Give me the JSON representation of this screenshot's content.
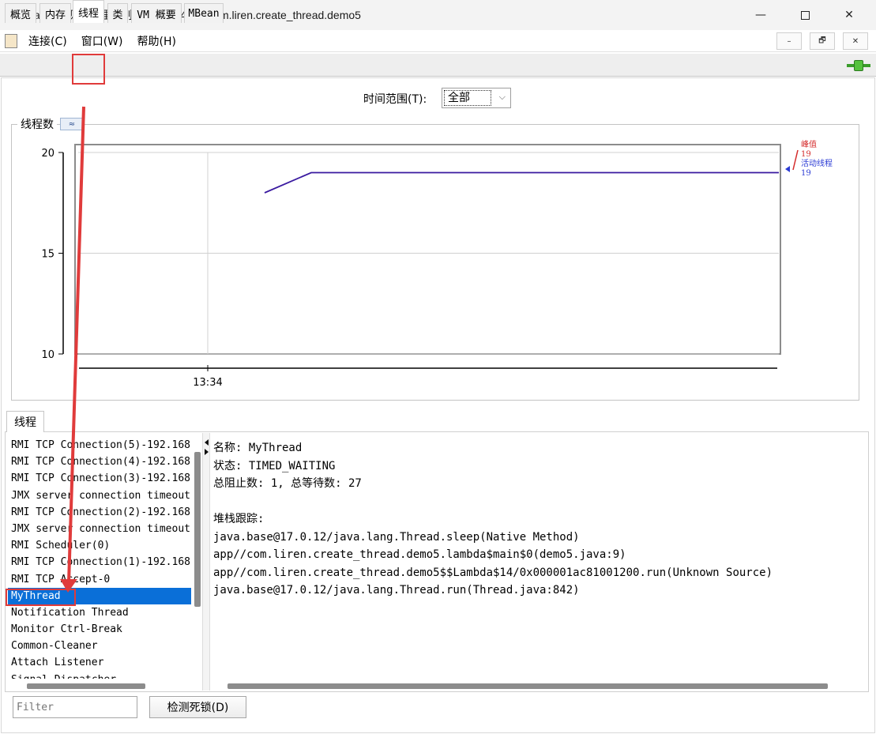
{
  "window": {
    "title": "Java 监视和管理控制台 - pid: 24128 com.liren.create_thread.demo5",
    "minimize": "—",
    "close": "✕"
  },
  "menu": {
    "items": [
      "连接(C)",
      "窗口(W)",
      "帮助(H)"
    ],
    "mdi_buttons": [
      "–",
      "🗗",
      "✕"
    ]
  },
  "tabs": [
    "概览",
    "内存",
    "线程",
    "类",
    "VM 概要",
    "MBean"
  ],
  "time_range": {
    "label": "时间范围(T):",
    "value": "全部",
    "chevron": "⌵"
  },
  "chart_section": {
    "title": "线程数",
    "collapse": "≈"
  },
  "chart_data": {
    "type": "line",
    "yticks": [
      "20",
      "15",
      "10"
    ],
    "ylim": [
      10,
      20
    ],
    "xticks": [
      "13:34"
    ],
    "series": [
      {
        "name": "峰值",
        "color": "#d42b2b",
        "value": "19"
      },
      {
        "name": "活动线程",
        "color": "#2b3bd4",
        "value": "19",
        "points": [
          18,
          19,
          19,
          19,
          19
        ]
      }
    ],
    "grid": true,
    "legend": "right"
  },
  "threads_section": {
    "tab": "线程",
    "list": [
      "RMI TCP Connection(5)-192.168",
      "RMI TCP Connection(4)-192.168",
      "RMI TCP Connection(3)-192.168",
      "JMX server connection timeout",
      "RMI TCP Connection(2)-192.168",
      "JMX server connection timeout",
      "RMI Scheduler(0)",
      "RMI TCP Connection(1)-192.168",
      "RMI TCP Accept-0",
      "MyThread",
      "Notification Thread",
      "Monitor Ctrl-Break",
      "Common-Cleaner",
      "Attach Listener",
      "Signal Dispatcher"
    ],
    "selected": "MyThread",
    "detail": [
      "名称: MyThread",
      "状态: TIMED_WAITING",
      "总阻止数: 1, 总等待数: 27",
      "",
      "堆栈跟踪:",
      "java.base@17.0.12/java.lang.Thread.sleep(Native Method)",
      "app//com.liren.create_thread.demo5.lambda$main$0(demo5.java:9)",
      "app//com.liren.create_thread.demo5$$Lambda$14/0x000001ac81001200.run(Unknown Source)",
      "java.base@17.0.12/java.lang.Thread.run(Thread.java:842)"
    ],
    "filter_placeholder": "Filter",
    "deadlock_button": "检测死锁(D)"
  },
  "colors": {
    "annotation": "#e03b3b",
    "selection": "#0a6fd8",
    "peak": "#d42b2b",
    "live": "#2b3bd4",
    "series_line": "#3a1aa0"
  }
}
